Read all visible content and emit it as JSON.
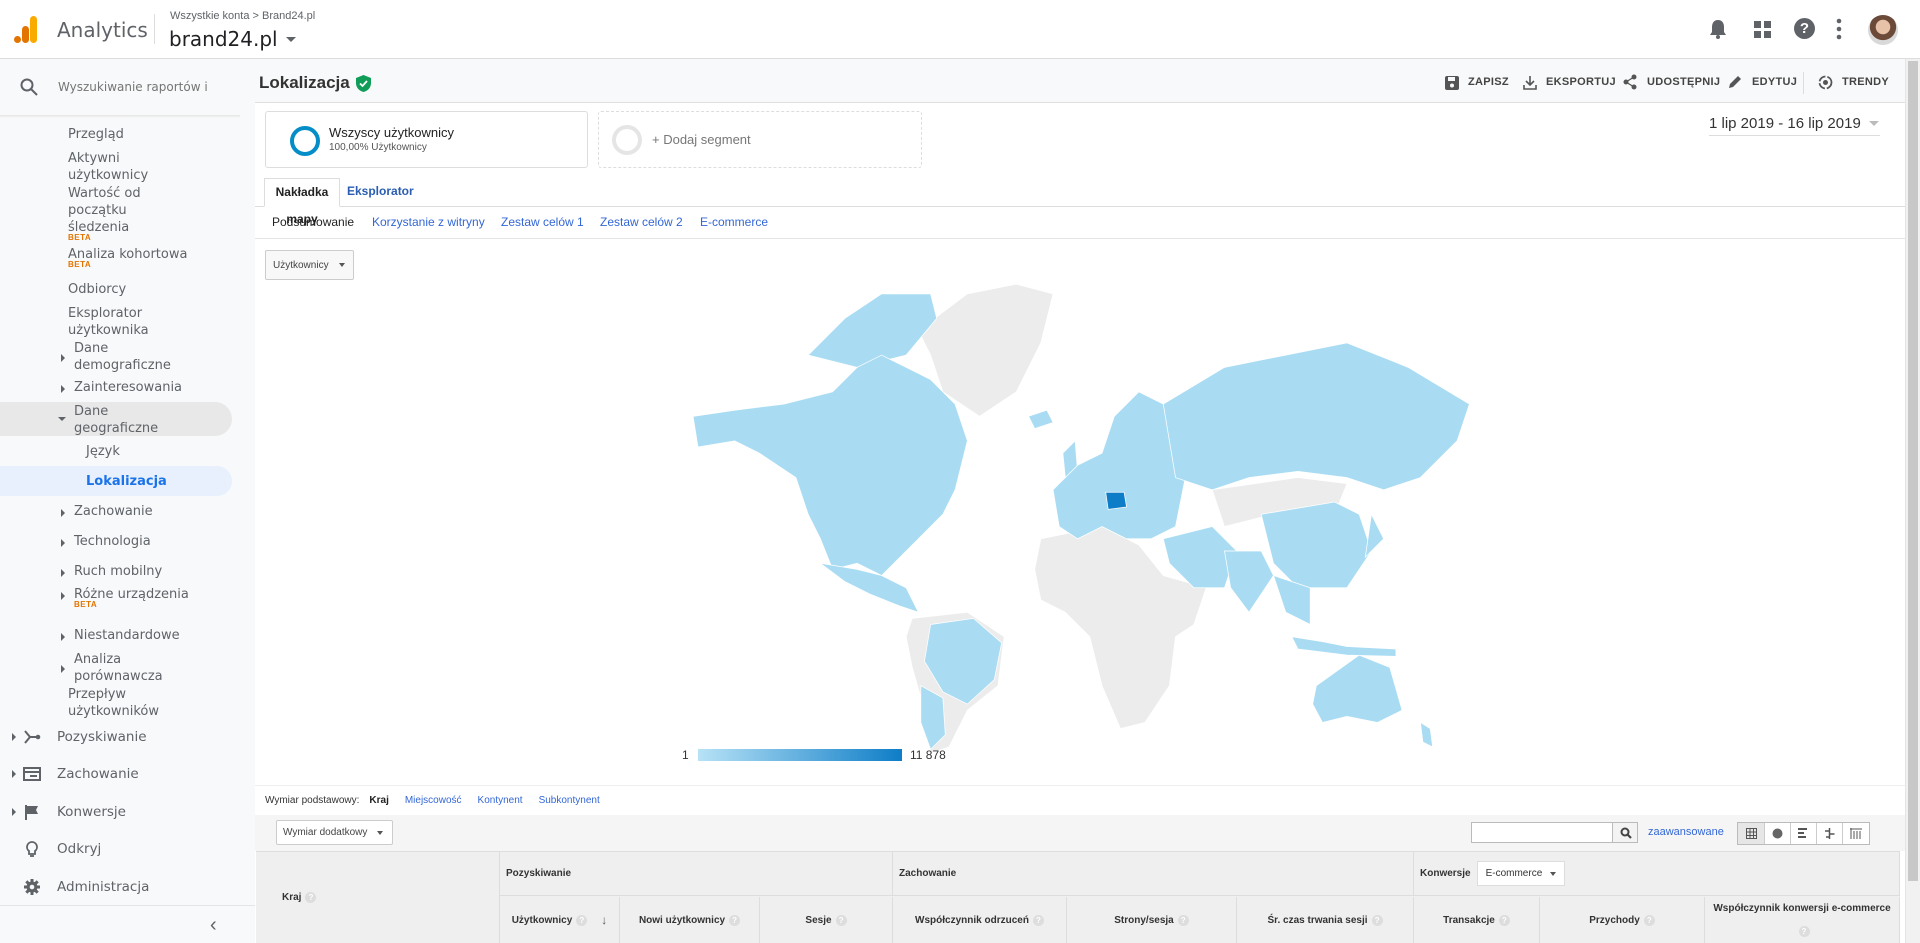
{
  "header": {
    "app_name": "Analytics",
    "breadcrumb": "Wszystkie konta > Brand24.pl",
    "property": "brand24.pl"
  },
  "search": {
    "placeholder": "Wyszukiwanie raportów i pc"
  },
  "sidebar": {
    "audience_items": [
      {
        "label": "Przegląd"
      },
      {
        "label": "Aktywni\nużytkownicy"
      },
      {
        "label": "Wartość od\npoczątku\nśledzenia",
        "badge": "BETA"
      },
      {
        "label": "Analiza kohortowa",
        "badge": "BETA"
      },
      {
        "label": "Odbiorcy"
      },
      {
        "label": "Eksplorator\nużytkownika"
      },
      {
        "label": "Dane\ndemograficzne"
      },
      {
        "label": "Zainteresowania"
      },
      {
        "label": "Dane\ngeograficzne"
      },
      {
        "label": "Język"
      },
      {
        "label": "Lokalizacja"
      },
      {
        "label": "Zachowanie"
      },
      {
        "label": "Technologia"
      },
      {
        "label": "Ruch mobilny"
      },
      {
        "label": "Różne urządzenia",
        "badge": "BETA"
      },
      {
        "label": "Niestandardowe"
      },
      {
        "label": "Analiza\nporównawcza"
      },
      {
        "label": "Przepływ\nużytkowników"
      }
    ],
    "sections": [
      {
        "label": "Pozyskiwanie",
        "icon": "acquisition-icon"
      },
      {
        "label": "Zachowanie",
        "icon": "behavior-icon"
      },
      {
        "label": "Konwersje",
        "icon": "flag-icon"
      },
      {
        "label": "Odkryj",
        "icon": "lightbulb-icon"
      },
      {
        "label": "Administracja",
        "icon": "gear-icon"
      }
    ]
  },
  "page": {
    "title": "Lokalizacja"
  },
  "toolbar": {
    "save": "ZAPISZ",
    "export": "EKSPORTUJ",
    "share": "UDOSTĘPNIJ",
    "edit": "EDYTUJ",
    "trends": "TRENDY"
  },
  "date_range": "1 lip 2019 - 16 lip 2019",
  "segments": {
    "active_name": "Wszyscy użytkownicy",
    "active_sub": "100,00% Użytkownicy",
    "add": "+ Dodaj segment"
  },
  "tabs": [
    {
      "label": "Nakładka mapy",
      "active": true
    },
    {
      "label": "Eksplorator",
      "active": false
    }
  ],
  "subtabs": [
    {
      "label": "Podsumowanie",
      "active": true
    },
    {
      "label": "Korzystanie z witryny"
    },
    {
      "label": "Zestaw celów 1"
    },
    {
      "label": "Zestaw celów 2"
    },
    {
      "label": "E-commerce"
    }
  ],
  "metric_select": "Użytkownicy",
  "map": {
    "legend_min": "1",
    "legend_max": "11 878",
    "colors": {
      "with_users": "#a9dcf3",
      "no_data": "#ececec",
      "max": "#0e7dc7",
      "border": "#ffffff"
    },
    "highlighted_country": "Poland"
  },
  "dimension": {
    "label": "Wymiar podstawowy:",
    "options": [
      {
        "label": "Kraj",
        "active": true
      },
      {
        "label": "Miejscowość"
      },
      {
        "label": "Kontynent"
      },
      {
        "label": "Subkontynent"
      }
    ],
    "secondary": "Wymiar dodatkowy"
  },
  "table_tools": {
    "advanced": "zaawansowane",
    "views": [
      "table-view-icon",
      "pie-view-icon",
      "performance-view-icon",
      "comparison-view-icon",
      "pivot-view-icon"
    ]
  },
  "table": {
    "col_country": "Kraj",
    "groups": [
      {
        "label": "Pozyskiwanie"
      },
      {
        "label": "Zachowanie"
      },
      {
        "label": "Konwersje",
        "select": "E-commerce"
      }
    ],
    "columns": [
      "Użytkownicy",
      "Nowi użytkownicy",
      "Sesje",
      "Współczynnik odrzuceń",
      "Strony/sesja",
      "Śr. czas trwania sesji",
      "Transakcje",
      "Przychody",
      "Współczynnik konwersji e-commerce"
    ],
    "sort_column": "Użytkownicy"
  }
}
